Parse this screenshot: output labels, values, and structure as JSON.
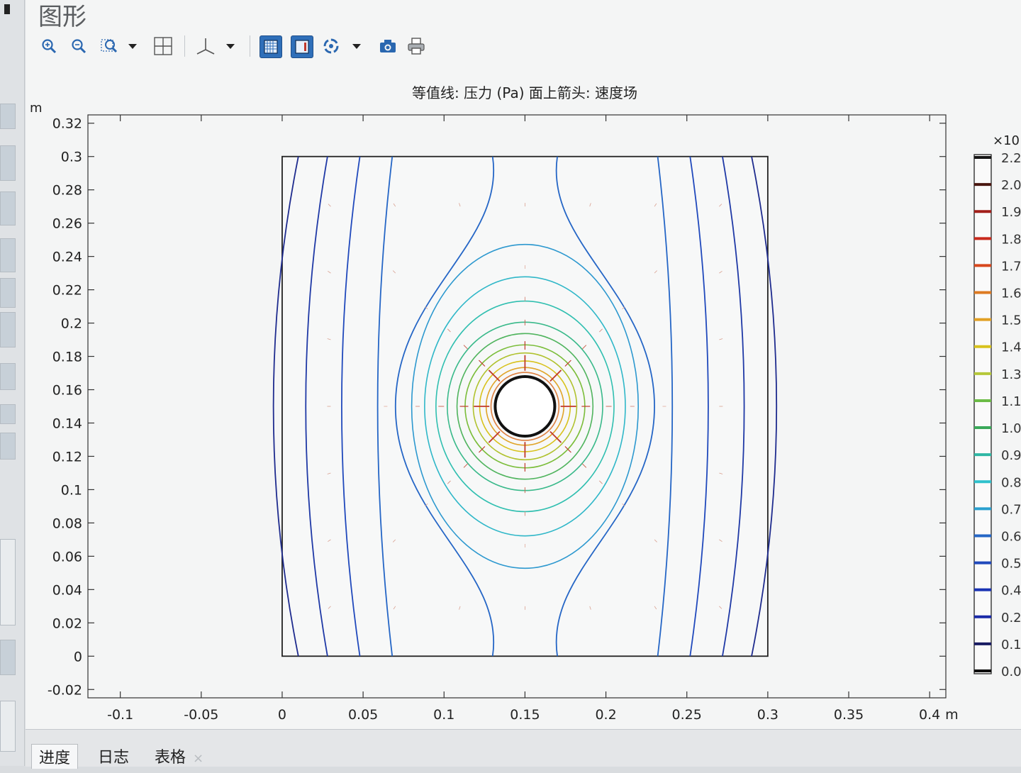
{
  "window": {
    "title": "图形"
  },
  "toolbar": {
    "icons": [
      "zoom-box-icon",
      "zoom-out-icon",
      "zoom-extents-icon",
      "dropdown-arrow-icon",
      "grid-pan-icon",
      "axis-icon",
      "dropdown-arrow-icon",
      "grid-toggle-icon",
      "legend-toggle-icon",
      "rotate-icon",
      "dropdown-arrow-icon",
      "camera-icon",
      "print-icon"
    ]
  },
  "plot": {
    "title": "等值线: 压力 (Pa)  面上箭头: 速度场",
    "y_unit": "m",
    "x_unit": "m",
    "legend_multiplier": "×10",
    "legend_labels": [
      "2.2",
      "2.0",
      "1.9",
      "1.8",
      "1.7",
      "1.6",
      "1.5",
      "1.4",
      "1.3",
      "1.1",
      "1.0",
      "0.9",
      "0.8",
      "0.7",
      "0.6",
      "0.5",
      "0.4",
      "0.2",
      "0.1",
      "0.0"
    ],
    "legend_colors": [
      "#151515",
      "#4a1710",
      "#a21f1a",
      "#c92a1d",
      "#d8471d",
      "#dd7a22",
      "#e2a024",
      "#d8c21c",
      "#b6c83a",
      "#6cbc46",
      "#3aa95a",
      "#2fb7a4",
      "#2fc1cc",
      "#2aa0cf",
      "#2566c6",
      "#2049bc",
      "#1a33b4",
      "#1a2aa8",
      "#191b63",
      "#0b0b0b"
    ]
  },
  "chart_data": {
    "type": "contour",
    "title": "等值线: 压力 (Pa)  面上箭头: 速度场",
    "xlabel": "m",
    "ylabel": "m",
    "xlim": [
      -0.12,
      0.41
    ],
    "ylim": [
      -0.025,
      0.325
    ],
    "x_ticks": [
      "-0.1",
      "-0.05",
      "0",
      "0.05",
      "0.1",
      "0.15",
      "0.2",
      "0.25",
      "0.3",
      "0.35",
      "0.4"
    ],
    "y_ticks": [
      "0.32",
      "0.3",
      "0.28",
      "0.26",
      "0.24",
      "0.22",
      "0.2",
      "0.18",
      "0.16",
      "0.14",
      "0.12",
      "0.1",
      "0.08",
      "0.06",
      "0.04",
      "0.02",
      "0",
      "-0.02"
    ],
    "domain": {
      "x": [
        0,
        0.3
      ],
      "y": [
        0,
        0.3
      ]
    },
    "source": {
      "x": 0.15,
      "y": 0.15
    },
    "vertical_contour_x": [
      0.01,
      0.028,
      0.048,
      0.068,
      0.232,
      0.252,
      0.272,
      0.29
    ],
    "hourglass_contour": {
      "waist_offset": 0.02,
      "bulge_offset": 0.08
    },
    "ellipse_contours": [
      {
        "rx": 0.07,
        "ry": 0.1,
        "color": "#2c98cf"
      },
      {
        "rx": 0.062,
        "ry": 0.08,
        "color": "#2fb7c8"
      },
      {
        "rx": 0.055,
        "ry": 0.065,
        "color": "#30bfb0"
      },
      {
        "rx": 0.048,
        "ry": 0.052,
        "color": "#39b98a"
      },
      {
        "rx": 0.042,
        "ry": 0.045,
        "color": "#50b45e"
      },
      {
        "rx": 0.037,
        "ry": 0.038,
        "color": "#7bbd3a"
      },
      {
        "rx": 0.032,
        "ry": 0.033,
        "color": "#b0c22e"
      },
      {
        "rx": 0.028,
        "ry": 0.028,
        "color": "#d8c21c"
      },
      {
        "rx": 0.024,
        "ry": 0.024,
        "color": "#e0a428"
      },
      {
        "rx": 0.021,
        "ry": 0.021,
        "color": "#dd8040"
      },
      {
        "rx": 0.018,
        "ry": 0.018,
        "color": "#d55a48"
      },
      {
        "rx": 0.016,
        "ry": 0.016,
        "color": "#c8404a"
      },
      {
        "rx": 0.014,
        "ry": 0.014,
        "color": "#b03040"
      },
      {
        "rx": 0.0125,
        "ry": 0.0125,
        "color": "#9a2838"
      },
      {
        "rx": 0.011,
        "ry": 0.011,
        "color": "#80222e"
      },
      {
        "rx": 0.0098,
        "ry": 0.0098,
        "color": "#621b22"
      },
      {
        "rx": 0.0088,
        "ry": 0.0088,
        "color": "#401414"
      }
    ],
    "hole_radius": 0.008
  },
  "bottom_tabs": [
    {
      "label": "进度",
      "active": true
    },
    {
      "label": "日志",
      "active": false
    },
    {
      "label": "表格",
      "active": false,
      "closable": true,
      "close": "×"
    }
  ]
}
